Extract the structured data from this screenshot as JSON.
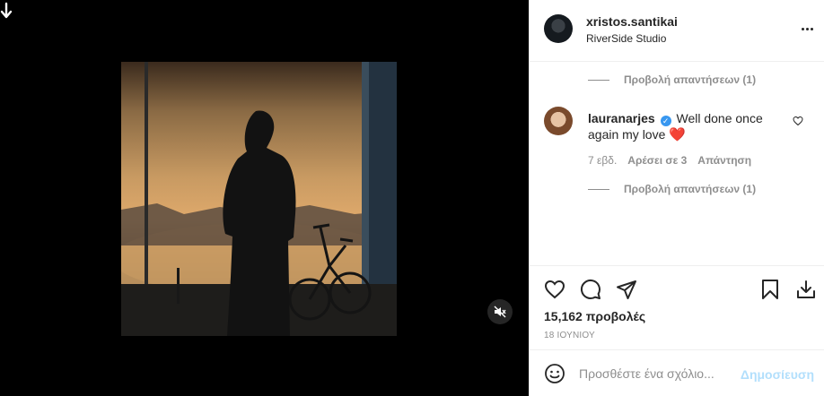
{
  "post": {
    "username": "xristos.santikai",
    "location": "RiverSide Studio",
    "more_icon": "more-horizontal-icon"
  },
  "media": {
    "type": "video",
    "mute_icon": "volume-off-icon",
    "corner_icon": "arrow-down-icon"
  },
  "comments": {
    "view_replies_top": "Προβολή απαντήσεων (1)",
    "item": {
      "username": "lauranarjes",
      "verified": true,
      "text": "Well done once again my love",
      "emoji": "❤️",
      "time": "7 εβδ.",
      "likes": "Αρέσει σε 3",
      "reply": "Απάντηση"
    },
    "view_replies_bottom": "Προβολή απαντήσεων (1)"
  },
  "actions": {
    "views": "15,162 προβολές",
    "date": "18 ΙΟΥΝΙΟΥ"
  },
  "add_comment": {
    "placeholder": "Προσθέστε ένα σχόλιο...",
    "post_label": "Δημοσίευση"
  },
  "colors": {
    "link_disabled": "#b2dffc",
    "secondary_text": "#8e8e8e",
    "verified": "#3897f0",
    "heart": "#ed4956"
  }
}
